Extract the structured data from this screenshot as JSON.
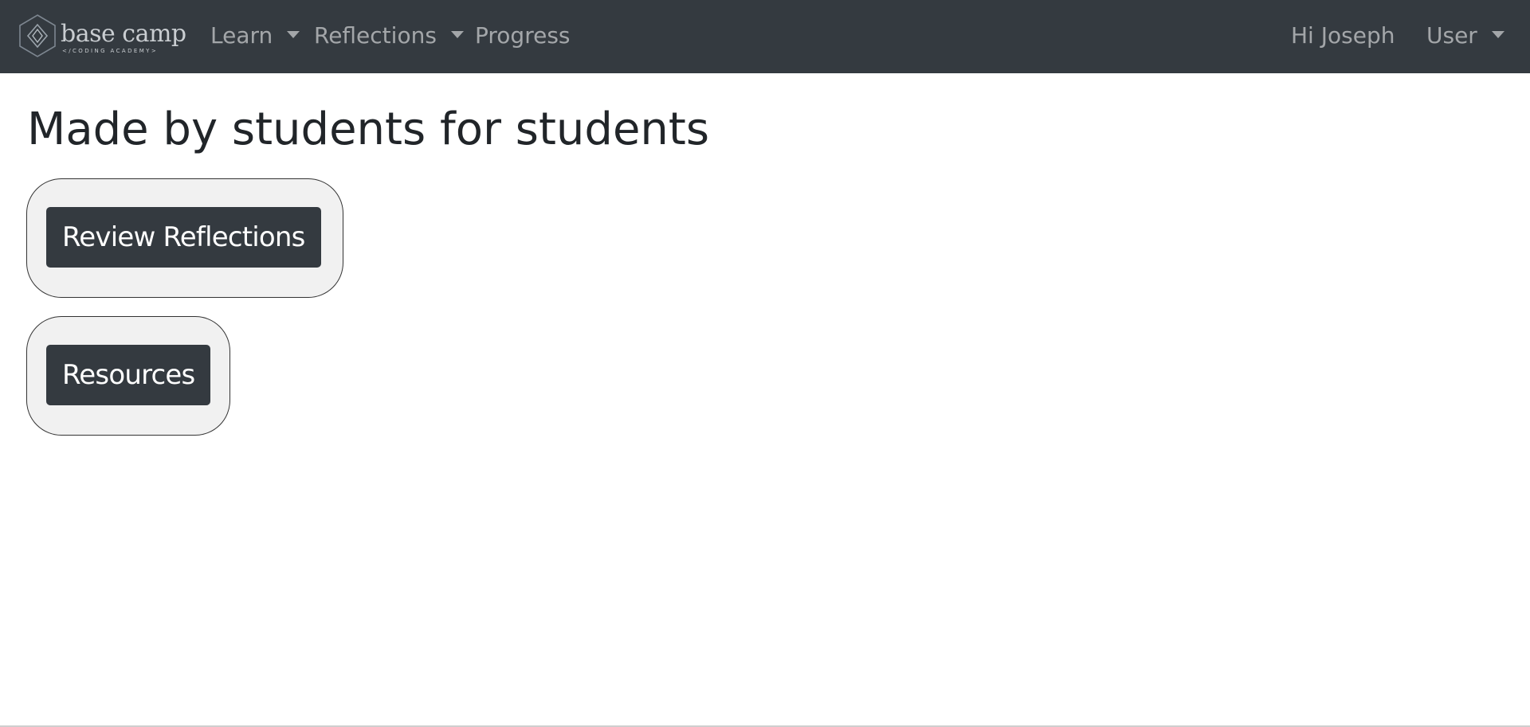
{
  "navbar": {
    "brand": {
      "name": "base camp",
      "tagline": "</CODING ACADEMY>",
      "logo_icon": "hexagon-diamond-logo-icon"
    },
    "links": [
      {
        "label": "Learn",
        "dropdown": true
      },
      {
        "label": "Reflections",
        "dropdown": true
      },
      {
        "label": "Progress",
        "dropdown": false
      }
    ],
    "greeting": "Hi Joseph",
    "user_menu": {
      "label": "User",
      "dropdown": true
    },
    "background_color": "#343a40"
  },
  "main": {
    "title": "Made by students for students",
    "cards": [
      {
        "button_label": "Review Reflections"
      },
      {
        "button_label": "Resources"
      }
    ]
  }
}
